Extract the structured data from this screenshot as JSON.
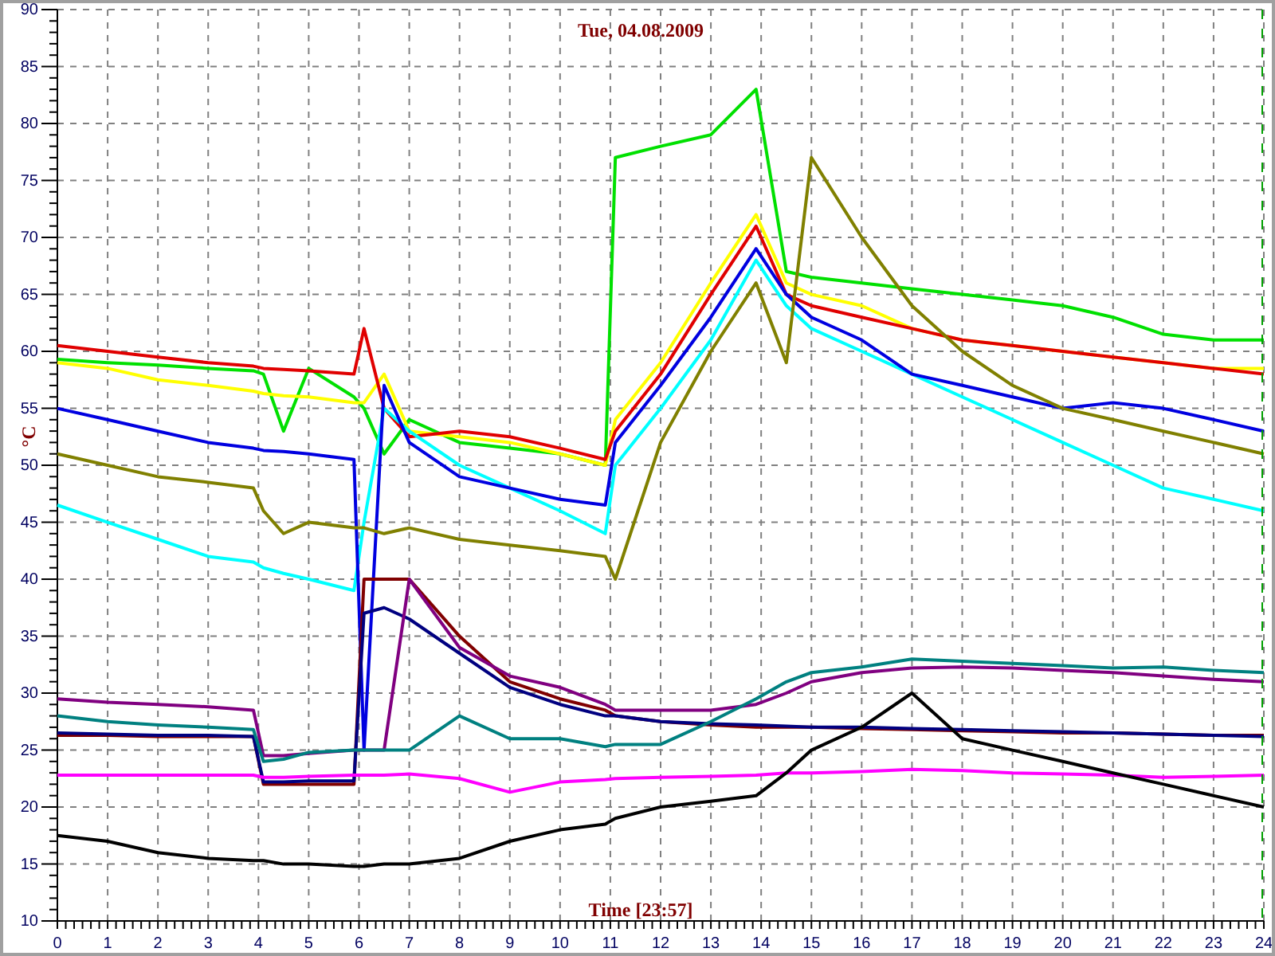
{
  "chart_data": {
    "type": "line",
    "title": "Tue, 04.08.2009",
    "xlabel": "Time [23:57]",
    "ylabel": "°C",
    "grid": true,
    "xlim": [
      0,
      24
    ],
    "ylim": [
      10,
      90
    ],
    "xticks": [
      0,
      1,
      2,
      3,
      4,
      5,
      6,
      7,
      8,
      9,
      10,
      11,
      12,
      13,
      14,
      15,
      16,
      17,
      18,
      19,
      20,
      21,
      22,
      23,
      24
    ],
    "yticks": [
      10,
      15,
      20,
      25,
      30,
      35,
      40,
      45,
      50,
      55,
      60,
      65,
      70,
      75,
      80,
      85,
      90
    ],
    "x": [
      0,
      1,
      2,
      3,
      3.9,
      4.1,
      4.5,
      5,
      5.9,
      6.1,
      6.5,
      7,
      8,
      9,
      10,
      10.9,
      11.1,
      12,
      13,
      13.9,
      14.5,
      15,
      16,
      17,
      18,
      19,
      20,
      21,
      22,
      23,
      24
    ],
    "series": [
      {
        "color": "#00e000",
        "values": [
          59.3,
          59,
          58.8,
          58.5,
          58.3,
          58,
          53,
          58.5,
          56,
          55,
          51,
          54,
          52,
          51.5,
          51,
          50,
          77,
          78,
          79,
          83,
          67,
          66.5,
          66,
          65.5,
          65,
          64.5,
          64,
          63,
          61.5,
          61,
          61
        ]
      },
      {
        "color": "#ffff00",
        "values": [
          59,
          58.5,
          57.5,
          57,
          56.5,
          56.3,
          56.1,
          56,
          55.5,
          55.5,
          58,
          53,
          52.5,
          52,
          51,
          50,
          54,
          59,
          66,
          72,
          66,
          65,
          64,
          62,
          61,
          60.5,
          60,
          59.5,
          59,
          58.5,
          58.5
        ]
      },
      {
        "color": "#e00000",
        "values": [
          60.5,
          60,
          59.5,
          59,
          58.7,
          58.5,
          58.4,
          58.3,
          58,
          62,
          55,
          52.5,
          53,
          52.5,
          51.5,
          50.5,
          53,
          58,
          65,
          71,
          65,
          64,
          63,
          62,
          61,
          60.5,
          60,
          59.5,
          59,
          58.5,
          58
        ]
      },
      {
        "color": "#00ffff",
        "values": [
          46.5,
          45,
          43.5,
          42,
          41.5,
          41,
          40.5,
          40,
          39,
          45,
          55,
          53,
          50,
          48,
          46,
          44,
          50,
          55,
          61,
          68,
          64,
          62,
          60,
          58,
          56,
          54,
          52,
          50,
          48,
          47,
          46
        ]
      },
      {
        "color": "#0000e0",
        "values": [
          55,
          54,
          53,
          52,
          51.5,
          51.3,
          51.2,
          51,
          50.5,
          25,
          57,
          52,
          49,
          48,
          47,
          46.5,
          52,
          57,
          63,
          69,
          65,
          63,
          61,
          58,
          57,
          56,
          55,
          55.5,
          55,
          54,
          53
        ]
      },
      {
        "color": "#808000",
        "values": [
          51,
          50,
          49,
          48.5,
          48,
          46,
          44,
          45,
          44.5,
          44.5,
          44,
          44.5,
          43.5,
          43,
          42.5,
          42,
          40,
          52,
          60,
          66,
          59,
          77,
          70,
          64,
          60,
          57,
          55,
          54,
          53,
          52,
          51
        ]
      },
      {
        "color": "#800000",
        "values": [
          26.3,
          26.3,
          26.2,
          26.2,
          26.2,
          22,
          22,
          22,
          22,
          40,
          40,
          40,
          35,
          31,
          29.5,
          28.5,
          28,
          27.5,
          27.2,
          27,
          27,
          27,
          26.9,
          26.8,
          26.7,
          26.6,
          26.5,
          26.5,
          26.4,
          26.3,
          26.3
        ]
      },
      {
        "color": "#000080",
        "values": [
          26.5,
          26.4,
          26.3,
          26.3,
          26.2,
          22.2,
          22.2,
          22.3,
          22.3,
          37,
          37.5,
          36.5,
          33.5,
          30.5,
          29,
          28,
          28,
          27.5,
          27.3,
          27.2,
          27.1,
          27,
          27,
          26.9,
          26.8,
          26.7,
          26.6,
          26.5,
          26.4,
          26.3,
          26.2
        ]
      },
      {
        "color": "#800080",
        "values": [
          29.5,
          29.2,
          29,
          28.8,
          28.5,
          24.5,
          24.5,
          24.7,
          25,
          25,
          25,
          40,
          34,
          31.5,
          30.5,
          29,
          28.5,
          28.5,
          28.5,
          29,
          30,
          31,
          31.8,
          32.2,
          32.3,
          32.2,
          32,
          31.8,
          31.5,
          31.2,
          31
        ]
      },
      {
        "color": "#008080",
        "values": [
          28,
          27.5,
          27.2,
          27,
          26.8,
          24,
          24.2,
          24.8,
          25,
          25,
          25,
          25,
          28,
          26,
          26,
          25.3,
          25.5,
          25.5,
          27.5,
          29.5,
          31,
          31.8,
          32.3,
          33,
          32.8,
          32.6,
          32.4,
          32.2,
          32.3,
          32,
          31.8
        ]
      },
      {
        "color": "#ff00ff",
        "values": [
          22.8,
          22.8,
          22.8,
          22.8,
          22.8,
          22.6,
          22.6,
          22.7,
          22.8,
          22.8,
          22.8,
          22.9,
          22.5,
          21.3,
          22.2,
          22.4,
          22.5,
          22.6,
          22.7,
          22.8,
          23,
          23,
          23.1,
          23.3,
          23.2,
          23,
          22.9,
          22.8,
          22.6,
          22.7,
          22.8
        ]
      },
      {
        "color": "#000000",
        "values": [
          17.5,
          17,
          16,
          15.5,
          15.3,
          15.3,
          15,
          15,
          14.8,
          14.8,
          15,
          15,
          15.5,
          17,
          18,
          18.5,
          19,
          20,
          20.5,
          21,
          23,
          25,
          27,
          30,
          26,
          25,
          24,
          23,
          22,
          21,
          20
        ]
      }
    ]
  }
}
